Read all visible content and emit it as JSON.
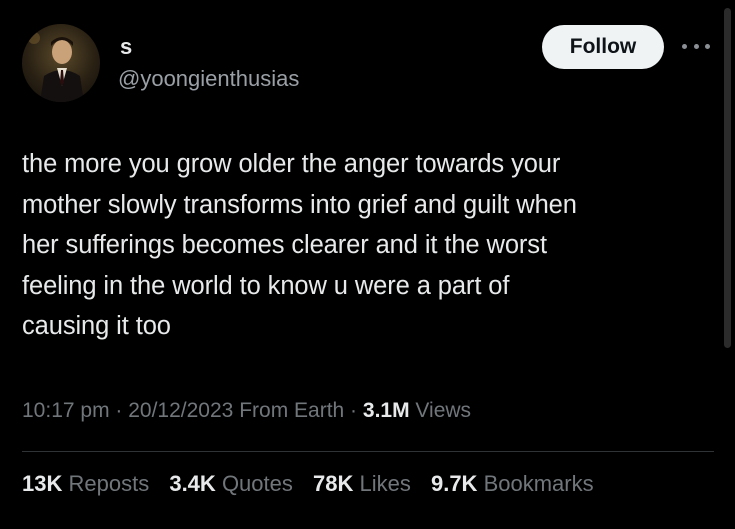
{
  "author": {
    "display_name": "s",
    "handle": "@yoongienthusias",
    "avatar_icon": "profile-photo-man-in-suit"
  },
  "follow_label": "Follow",
  "more_icon": "more-horizontal-icon",
  "tweet": {
    "text": "the more you grow older the anger towards your\nmother slowly transforms into grief and guilt when\nher sufferings becomes clearer and it the worst\nfeeling in the world to know u were a part of\ncausing it too"
  },
  "meta": {
    "time": "10:17 pm",
    "separator": " · ",
    "date": "20/12/2023",
    "source": "From Earth",
    "views_count": "3.1M",
    "views_label": "Views"
  },
  "stats": {
    "reposts_count": "13K",
    "reposts_label": "Reposts",
    "quotes_count": "3.4K",
    "quotes_label": "Quotes",
    "likes_count": "78K",
    "likes_label": "Likes",
    "bookmarks_count": "9.7K",
    "bookmarks_label": "Bookmarks"
  },
  "colors": {
    "background": "#000000",
    "primary_text": "#e7e9ea",
    "secondary_text": "#71767b",
    "follow_button_bg": "#eff3f4",
    "divider": "#2f3336"
  }
}
